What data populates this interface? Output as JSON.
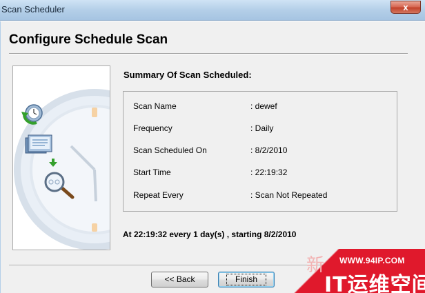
{
  "window": {
    "title": "Scan Scheduler",
    "close_label": "x"
  },
  "page": {
    "title": "Configure Schedule Scan"
  },
  "summary": {
    "heading": "Summary Of Scan Scheduled:",
    "rows": [
      {
        "label": "Scan Name",
        "value": ": dewef"
      },
      {
        "label": "Frequency",
        "value": ": Daily"
      },
      {
        "label": "Scan Scheduled On",
        "value": ": 8/2/2010"
      },
      {
        "label": "Start Time",
        "value": ": 22:19:32"
      },
      {
        "label": "Repeat Every",
        "value": ": Scan Not Repeated"
      }
    ],
    "schedule_text": "At 22:19:32 every 1 day(s) , starting 8/2/2010"
  },
  "buttons": {
    "back": "<< Back",
    "finish": "Finish"
  },
  "watermark": {
    "url": "WWW.94IP.COM",
    "brand": "IT运维空间",
    "faint": "新"
  },
  "colors": {
    "watermark_red": "#e0192c",
    "titlebar": "#b4cfe8"
  }
}
